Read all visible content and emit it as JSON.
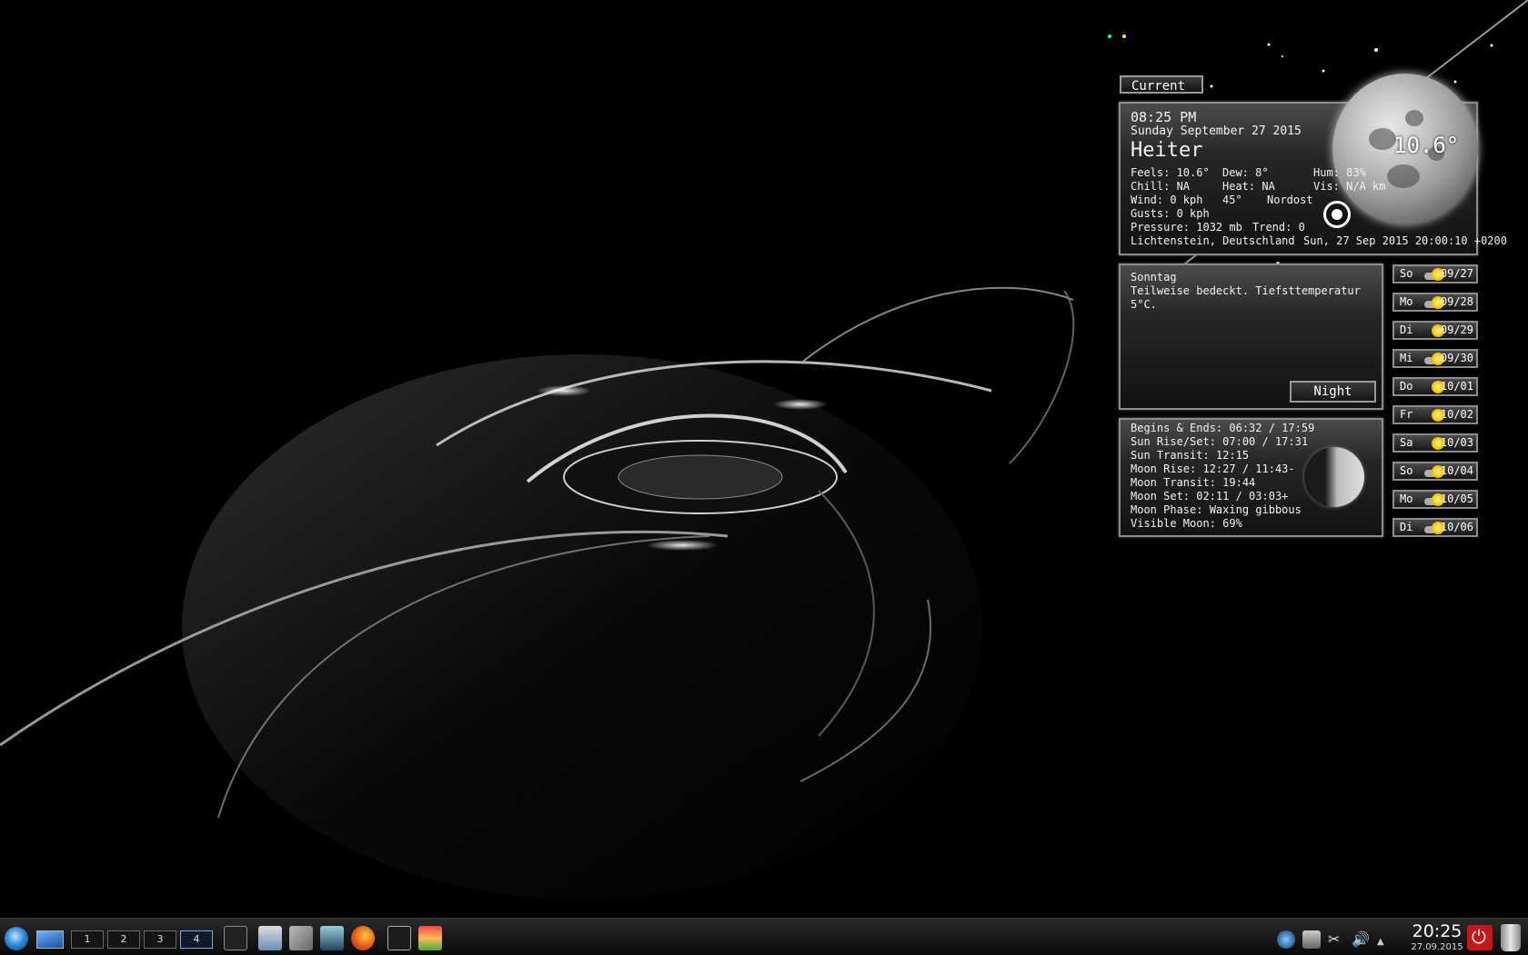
{
  "widget": {
    "tab_label": "Current",
    "current": {
      "time": "08:25 PM",
      "date": "Sunday September 27 2015",
      "condition": "Heiter",
      "temperature": "10.6°",
      "feels": "Feels: 10.6°",
      "dew": "Dew: 8°",
      "hum": "Hum: 83%",
      "chill": "Chill: NA",
      "heat": "Heat: NA",
      "vis": "Vis: N/A km",
      "wind": "Wind: 0 kph",
      "wind_deg": "45°",
      "wind_dir": "Nordost",
      "gusts": "Gusts: 0 kph",
      "pressure": "Pressure: 1032 mb",
      "trend": "Trend: 0",
      "location": "Lichtenstein, Deutschland",
      "updated": "Sun, 27 Sep 2015 20:00:10 +0200"
    },
    "forecast_text": {
      "day": "Sonntag",
      "line1": "Teilweise bedeckt. Tiefsttemperatur",
      "line2": "5°C.",
      "night_button": "Night"
    },
    "astro": {
      "begins_ends": "Begins & Ends: 06:32 / 17:59",
      "sun_rise_set": "Sun Rise/Set: 07:00 / 17:31",
      "sun_transit": "Sun Transit: 12:15",
      "moon_rise": "Moon Rise: 12:27 / 11:43-",
      "moon_transit": "Moon Transit: 19:44",
      "moon_set": "Moon Set: 02:11 / 03:03+",
      "moon_phase": "Moon Phase: Waxing gibbous",
      "visible_moon": "Visible Moon: 69%"
    },
    "days": [
      {
        "name": "So",
        "date": "09/27",
        "icon": "partly-cloudy-icon"
      },
      {
        "name": "Mo",
        "date": "09/28",
        "icon": "partly-cloudy-icon"
      },
      {
        "name": "Di",
        "date": "09/29",
        "icon": "sun-icon"
      },
      {
        "name": "Mi",
        "date": "09/30",
        "icon": "partly-cloudy-icon"
      },
      {
        "name": "Do",
        "date": "10/01",
        "icon": "sun-icon"
      },
      {
        "name": "Fr",
        "date": "10/02",
        "icon": "sun-icon"
      },
      {
        "name": "Sa",
        "date": "10/03",
        "icon": "sun-icon"
      },
      {
        "name": "So",
        "date": "10/04",
        "icon": "partly-cloudy-icon"
      },
      {
        "name": "Mo",
        "date": "10/05",
        "icon": "partly-cloudy-icon"
      },
      {
        "name": "Di",
        "date": "10/06",
        "icon": "partly-cloudy-icon"
      }
    ]
  },
  "taskbar": {
    "desktops": [
      "1",
      "2",
      "3",
      "4"
    ],
    "active_desktop": "4",
    "clock_time": "20:25",
    "clock_date": "27.09.2015"
  },
  "colors": {
    "background": "#000000",
    "panel_border": "#8c8c8c",
    "power_button": "#c8141b"
  }
}
